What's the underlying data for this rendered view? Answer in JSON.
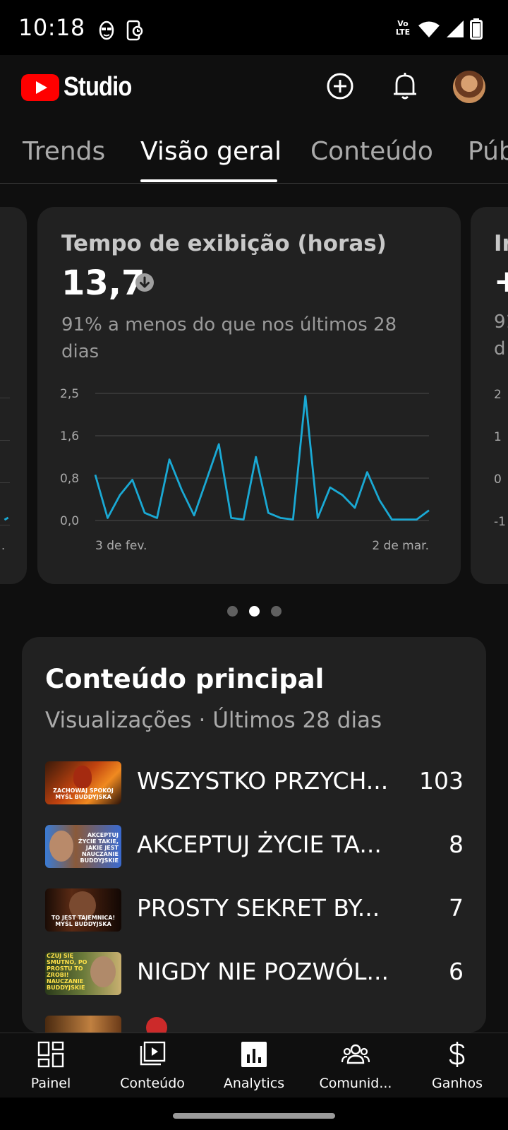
{
  "status_bar": {
    "time": "10:18",
    "network": "Vo LTE"
  },
  "app_bar": {
    "brand": "Studio"
  },
  "tabs": [
    {
      "label": "Trends"
    },
    {
      "label": "Visão geral"
    },
    {
      "label": "Conteúdo"
    },
    {
      "label": "Púb"
    }
  ],
  "carousel": {
    "left_card": {
      "ytick_label_bottom": "."
    },
    "main_card": {
      "title": "Tempo de exibição (horas)",
      "value": "13,7",
      "trend": "down",
      "description": "91% a menos do que nos últimos 28 dias"
    },
    "right_card": {
      "title_partial": "Ir",
      "value_partial": "+",
      "desc_partial_1": "91",
      "desc_partial_2": "d",
      "ytick_labels": [
        "2",
        "1",
        "0",
        "-1"
      ]
    },
    "page_indicator": {
      "count": 3,
      "active_index": 1
    }
  },
  "chart_data": {
    "type": "line",
    "x_labels": [
      "3 de fev.",
      "2 de mar."
    ],
    "y_ticks": [
      "2,5",
      "1,6",
      "0,8",
      "0,0"
    ],
    "ylim": [
      0,
      2.5
    ],
    "grid": true,
    "series": [
      {
        "values": [
          0.9,
          0.05,
          0.5,
          0.8,
          0.15,
          0.05,
          1.2,
          0.6,
          0.1,
          0.8,
          1.5,
          0.05,
          0.02,
          1.25,
          0.15,
          0.05,
          0.02,
          2.45,
          0.05,
          0.65,
          0.5,
          0.25,
          0.95,
          0.4,
          0.02,
          0.02,
          0.02,
          0.2
        ]
      }
    ],
    "colors": {
      "line": "#1aa9d4"
    }
  },
  "top_content": {
    "title": "Conteúdo principal",
    "subtitle": "Visualizações · Últimos 28 dias",
    "items": [
      {
        "title": "WSZYSTKO PRZYCH...",
        "views": "103",
        "thumb_text": "ZACHOWAJ SPOKÓJ MYŚL BUDDYJSKA"
      },
      {
        "title": "AKCEPTUJ ŻYCIE TA...",
        "views": "8",
        "thumb_text": "AKCEPTUJ ŻYCIE TAKIE, JAKIE JEST NAUCZANIE BUDDYJSKIE"
      },
      {
        "title": "PROSTY SEKRET BY...",
        "views": "7",
        "thumb_text": "TO JEST TAJEMNICA! MYŚL BUDDYJSKA"
      },
      {
        "title": "NIGDY NIE POZWÓL...",
        "views": "6",
        "thumb_text": "NIGDY NIE CZUJ SIĘ SMUTNO, PO PROSTU TO ZROBI! NAUCZANIE BUDDYJSKIE"
      }
    ]
  },
  "bottom_nav": [
    {
      "label": "Painel",
      "icon": "dashboard-icon"
    },
    {
      "label": "Conteúdo",
      "icon": "content-icon"
    },
    {
      "label": "Analytics",
      "icon": "analytics-icon"
    },
    {
      "label": "Comunid...",
      "icon": "community-icon"
    },
    {
      "label": "Ganhos",
      "icon": "dollar-icon"
    }
  ],
  "colors": {
    "accent_red": "#ff0000",
    "chart_line": "#1aa9d4",
    "background": "#0f0f0f",
    "card": "#212121"
  }
}
